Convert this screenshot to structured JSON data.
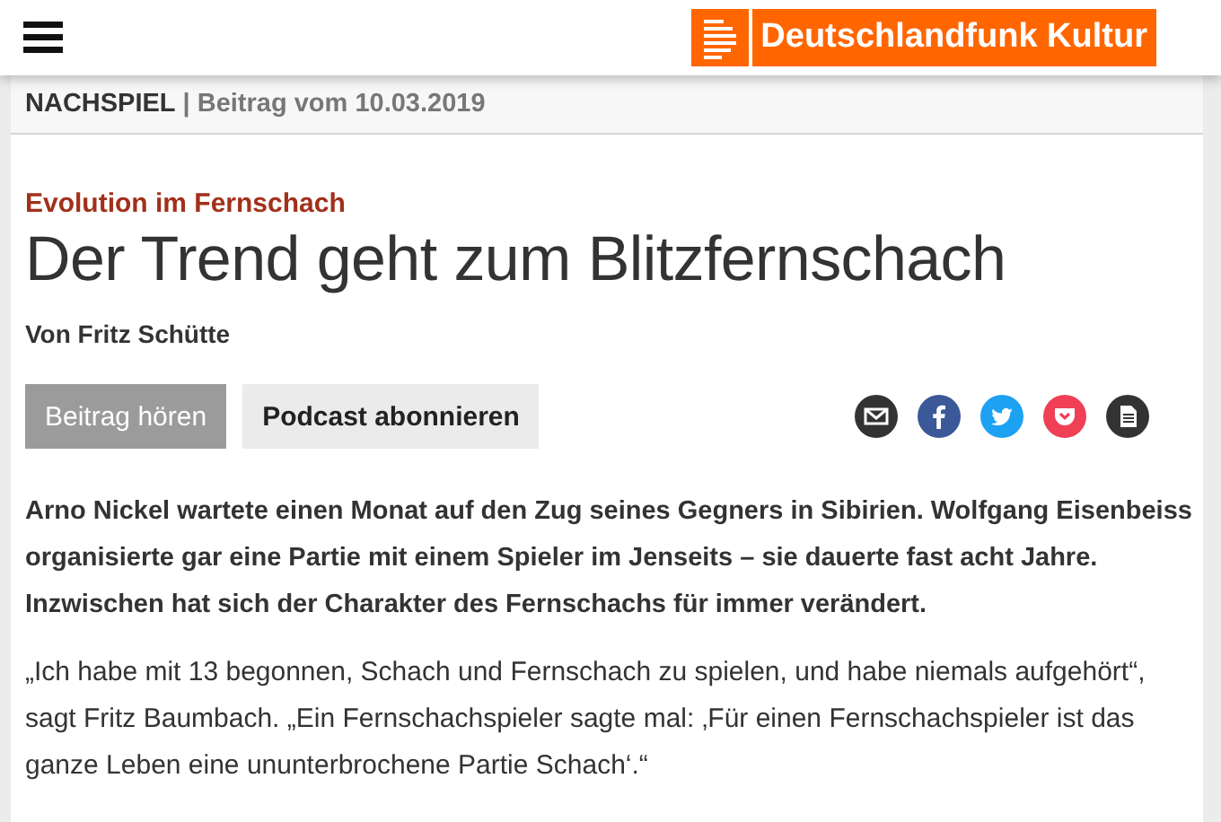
{
  "header": {
    "logo_text": "Deutschlandfunk Kultur"
  },
  "breadcrumb": {
    "section": "NACHSPIEL",
    "separator": "|",
    "meta": "Beitrag vom 10.03.2019"
  },
  "article": {
    "kicker": "Evolution im Fernschach",
    "title": "Der Trend geht zum Blitzfernschach",
    "author": "Von Fritz Schütte",
    "buttons": [
      {
        "label": "Beitrag hören",
        "kind": "primary"
      },
      {
        "label": "Podcast abonnieren",
        "kind": "secondary"
      }
    ],
    "share": [
      {
        "kind": "mail",
        "color": "#333333"
      },
      {
        "kind": "facebook",
        "color": "#3b5998"
      },
      {
        "kind": "twitter",
        "color": "#1da1f2"
      },
      {
        "kind": "pocket",
        "color": "#ef4056"
      },
      {
        "kind": "document",
        "color": "#333333"
      }
    ],
    "lead": "Arno Nickel wartete einen Monat auf den Zug seines Gegners in Sibirien. Wolfgang Eisenbeiss organisierte gar eine Partie mit einem Spieler im Jenseits – sie dauerte fast acht Jahre. Inzwischen hat sich der Charakter des Fernschachs für immer verändert.",
    "body": "„Ich habe mit 13 begonnen, Schach und Fernschach zu spielen, und habe niemals aufgehört“, sagt Fritz Baumbach. „Ein Fernschachspieler sagte mal: ‚Für einen Fernschachspieler ist das ganze Leben eine ununterbrochene Partie Schach‘.“"
  }
}
